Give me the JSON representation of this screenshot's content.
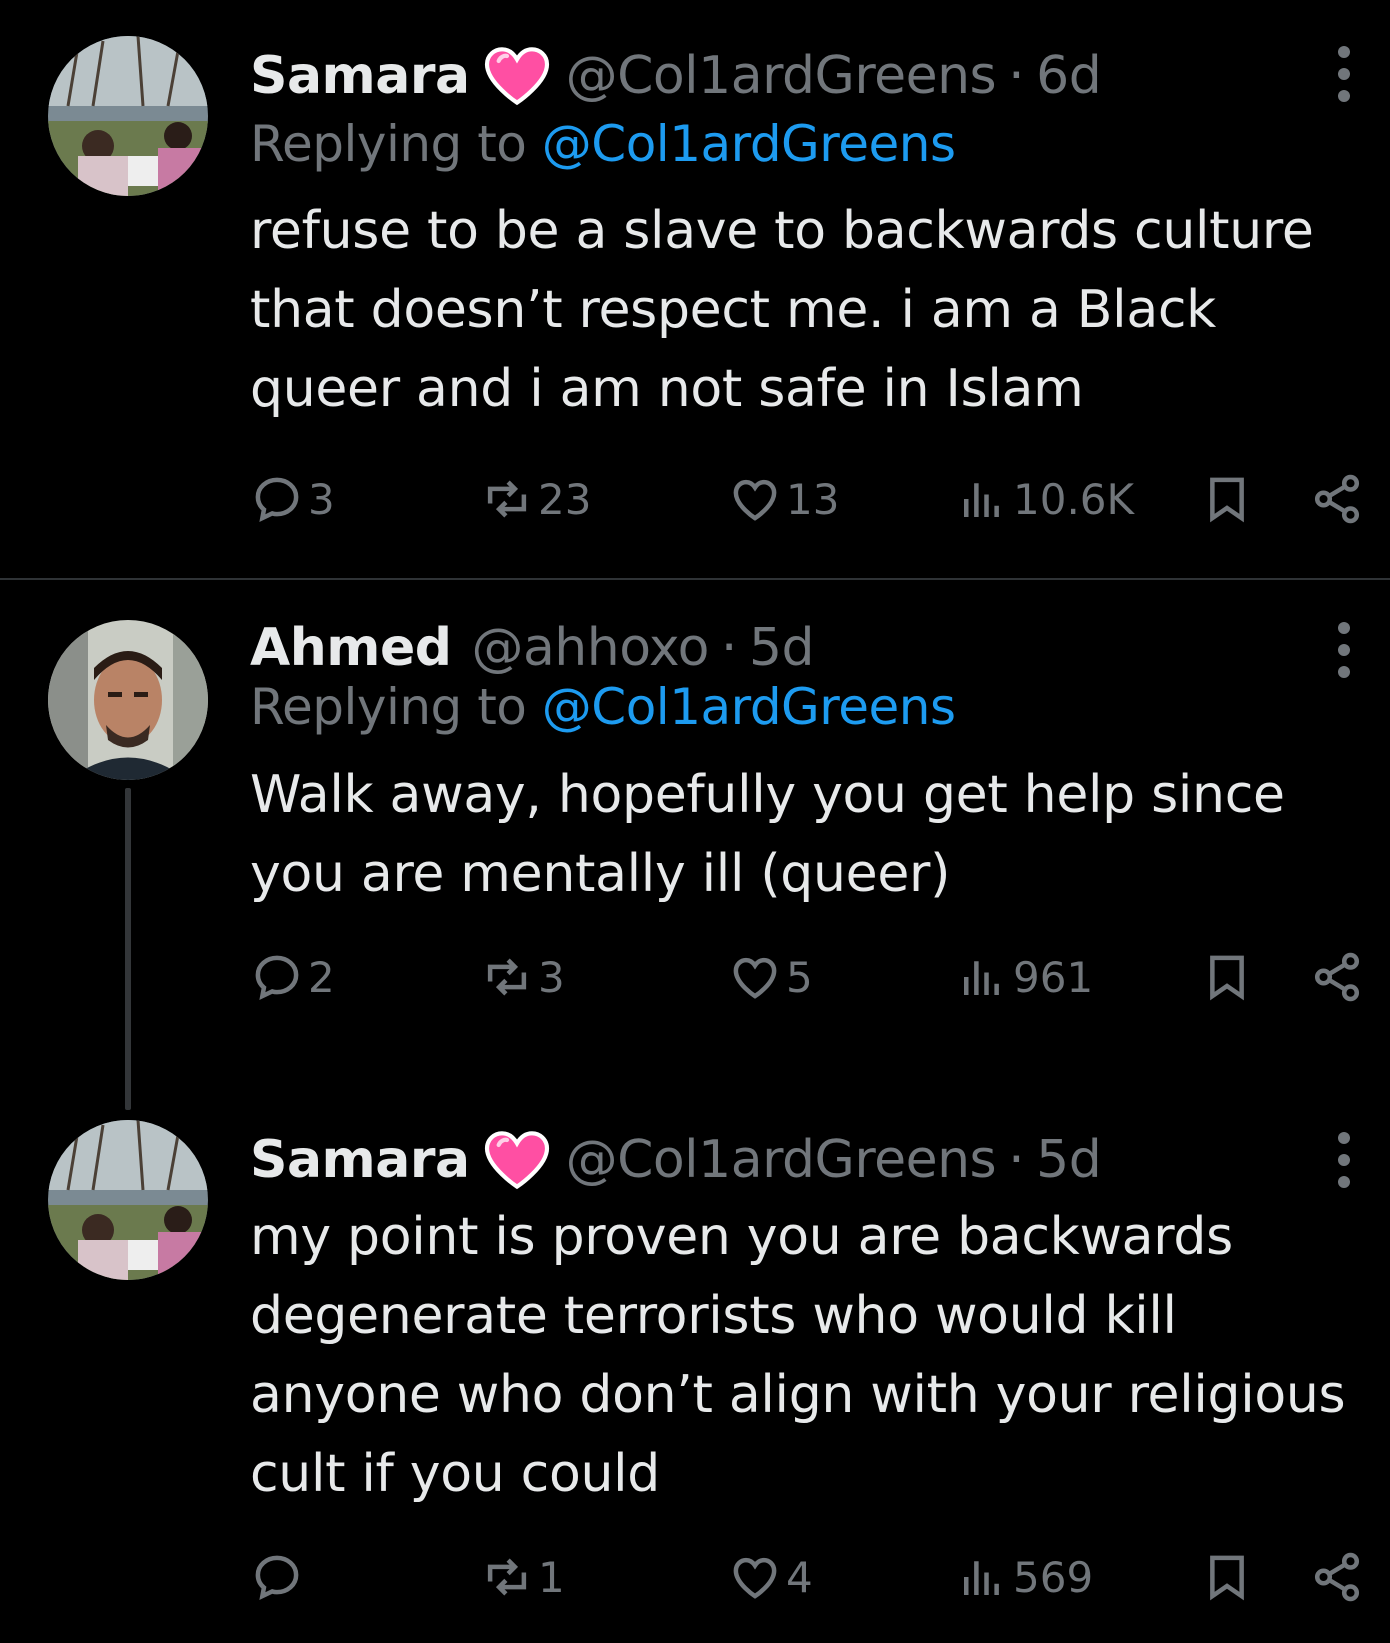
{
  "tweets": [
    {
      "name": "Samara",
      "heart": "pink-heart-emoji",
      "handle": "@Col1ardGreens",
      "time": "6d",
      "replying_label": "Replying to",
      "replying_to": "@Col1ardGreens",
      "text": "refuse to be a slave to backwards culture that doesn’t respect me. i am a Black queer and i am not safe in Islam",
      "replies": "3",
      "reposts": "23",
      "likes": "13",
      "views": "10.6K"
    },
    {
      "name": "Ahmed",
      "handle": "@ahhoxo",
      "time": "5d",
      "replying_label": "Replying to",
      "replying_to": "@Col1ardGreens",
      "text": "Walk away, hopefully you get help since you are mentally ill (queer)",
      "replies": "2",
      "reposts": "3",
      "likes": "5",
      "views": "961"
    },
    {
      "name": "Samara",
      "heart": "pink-heart-emoji",
      "handle": "@Col1ardGreens",
      "time": "5d",
      "text": "my point is proven you are backwards degenerate terrorists who would kill anyone who don’t align with your religious cult if you could",
      "replies": "",
      "reposts": "1",
      "likes": "4",
      "views": "569"
    }
  ],
  "separator": "·",
  "colors": {
    "background": "#000000",
    "text": "#e7e9ea",
    "muted": "#71767b",
    "link": "#1d9bf0",
    "heart": "#ff4fa3"
  }
}
